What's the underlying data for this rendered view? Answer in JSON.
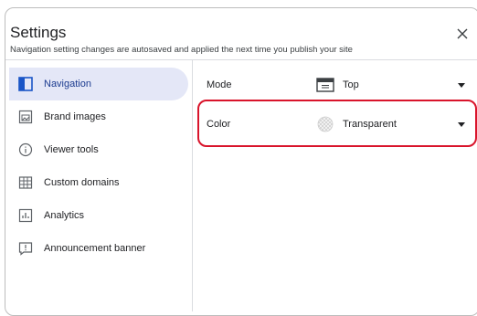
{
  "header": {
    "title": "Settings",
    "subtitle": "Navigation setting changes are autosaved and applied the next time you publish your site"
  },
  "sidebar": {
    "items": [
      {
        "label": "Navigation",
        "icon": "navigation-panel-icon",
        "active": true
      },
      {
        "label": "Brand images",
        "icon": "image-icon",
        "active": false
      },
      {
        "label": "Viewer tools",
        "icon": "info-icon",
        "active": false
      },
      {
        "label": "Custom domains",
        "icon": "domains-grid-icon",
        "active": false
      },
      {
        "label": "Analytics",
        "icon": "analytics-icon",
        "active": false
      },
      {
        "label": "Announcement banner",
        "icon": "banner-alert-icon",
        "active": false
      }
    ]
  },
  "main": {
    "mode": {
      "label": "Mode",
      "value": "Top",
      "icon": "top-nav-icon"
    },
    "color": {
      "label": "Color",
      "value": "Transparent",
      "icon": "transparent-swatch-icon"
    }
  },
  "colors": {
    "active_bg": "#e4e7f7",
    "active_accent": "#1a55c7",
    "highlight": "#d9142b"
  }
}
